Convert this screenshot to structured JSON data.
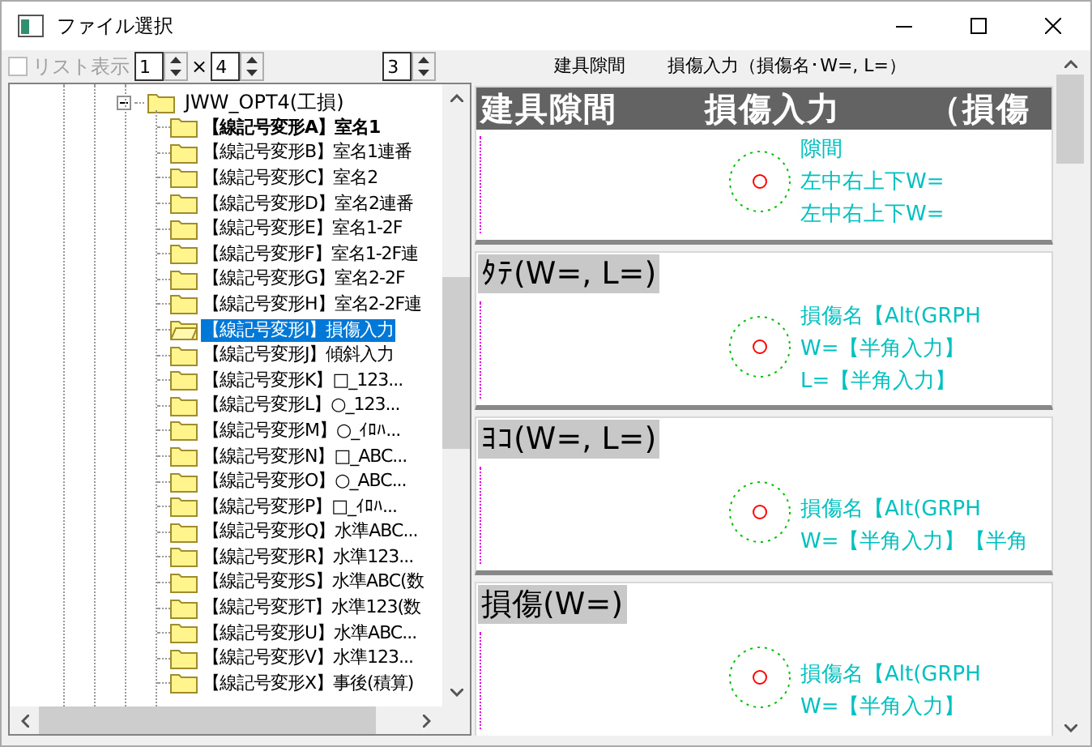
{
  "window": {
    "title": "ファイル選択"
  },
  "toolbar": {
    "list_view": {
      "label": "リスト表示",
      "checked": false,
      "disabled": true
    },
    "rows": "1",
    "times": "×",
    "cols": "4",
    "page": "3",
    "headers": [
      "建具隙間",
      "損傷入力（損傷名･W=, L=）"
    ]
  },
  "tree": {
    "root": {
      "label": "JWW_OPT4(工損)",
      "expanded": true,
      "children": [
        {
          "label": "【線記号変形A】室名1",
          "bold": true,
          "selected": false
        },
        {
          "label": "【線記号変形B】室名1連番",
          "bold": false,
          "selected": false
        },
        {
          "label": "【線記号変形C】室名2",
          "bold": false,
          "selected": false
        },
        {
          "label": "【線記号変形D】室名2連番",
          "bold": false,
          "selected": false
        },
        {
          "label": "【線記号変形E】室名1-2F",
          "bold": false,
          "selected": false
        },
        {
          "label": "【線記号変形F】室名1-2F連",
          "bold": false,
          "selected": false
        },
        {
          "label": "【線記号変形G】室名2-2F",
          "bold": false,
          "selected": false
        },
        {
          "label": "【線記号変形H】室名2-2F連",
          "bold": false,
          "selected": false
        },
        {
          "label": "【線記号変形I】損傷入力",
          "bold": false,
          "selected": true
        },
        {
          "label": "【線記号変形J】傾斜入力",
          "bold": false,
          "selected": false
        },
        {
          "label": "【線記号変形K】□_123...",
          "bold": false,
          "selected": false
        },
        {
          "label": "【線記号変形L】○_123...",
          "bold": false,
          "selected": false
        },
        {
          "label": "【線記号変形M】○_ｲﾛﾊ...",
          "bold": false,
          "selected": false
        },
        {
          "label": "【線記号変形N】□_ABC...",
          "bold": false,
          "selected": false
        },
        {
          "label": "【線記号変形O】○_ABC...",
          "bold": false,
          "selected": false
        },
        {
          "label": "【線記号変形P】□_ｲﾛﾊ...",
          "bold": false,
          "selected": false
        },
        {
          "label": "【線記号変形Q】水準ABC...",
          "bold": false,
          "selected": false
        },
        {
          "label": "【線記号変形R】水準123...",
          "bold": false,
          "selected": false
        },
        {
          "label": "【線記号変形S】水準ABC(数",
          "bold": false,
          "selected": false
        },
        {
          "label": "【線記号変形T】水準123(数",
          "bold": false,
          "selected": false
        },
        {
          "label": "【線記号変形U】水準ABC...",
          "bold": false,
          "selected": false
        },
        {
          "label": "【線記号変形V】水準123...",
          "bold": false,
          "selected": false
        },
        {
          "label": "【線記号変形X】事後(積算)",
          "bold": false,
          "selected": false
        }
      ]
    }
  },
  "preview": [
    {
      "kind": "dark",
      "header": [
        "建具隙間",
        "損傷入力",
        "（損傷"
      ],
      "lines": [
        "隙間",
        "左中右上下W=",
        "左中右上下W="
      ]
    },
    {
      "kind": "light",
      "header": [
        "ﾀﾃ(W=, L=)"
      ],
      "lines": [
        "損傷名【Alt(GRPH",
        "W=【半角入力】",
        "L=【半角入力】"
      ]
    },
    {
      "kind": "light",
      "header": [
        "ﾖｺ(W=, L=)"
      ],
      "lines": [
        "損傷名【Alt(GRPH",
        "W=【半角入力】【半角"
      ]
    },
    {
      "kind": "light",
      "header": [
        "損傷(W=)"
      ],
      "lines": [
        "損傷名【Alt(GRPH",
        "W=【半角入力】"
      ]
    }
  ]
}
